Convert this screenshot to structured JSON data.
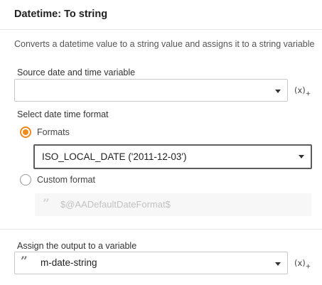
{
  "panel": {
    "title": "Datetime: To string",
    "description": "Converts a datetime value to a string value and assigns it to a string variable"
  },
  "source": {
    "label": "Source date and time variable",
    "value": "",
    "var_icon": "(x)",
    "var_icon_sub": "+"
  },
  "format": {
    "label": "Select date time format",
    "option_formats": "Formats",
    "formats_selected": true,
    "formats_value": "ISO_LOCAL_DATE ('2011-12-03')",
    "option_custom": "Custom format",
    "custom_selected": false,
    "custom_placeholder": "$@AADefaultDateFormat$"
  },
  "output": {
    "label": "Assign the output to a variable",
    "value": "m-date-string",
    "var_icon": "(x)",
    "var_icon_sub": "+"
  },
  "colors": {
    "accent": "#f08a1c",
    "focus_border": "#5c5c5c",
    "disabled_bg": "#f7f7f7"
  },
  "icons": [
    "caret-down-icon",
    "variable-insert-icon",
    "string-quote-icon"
  ]
}
